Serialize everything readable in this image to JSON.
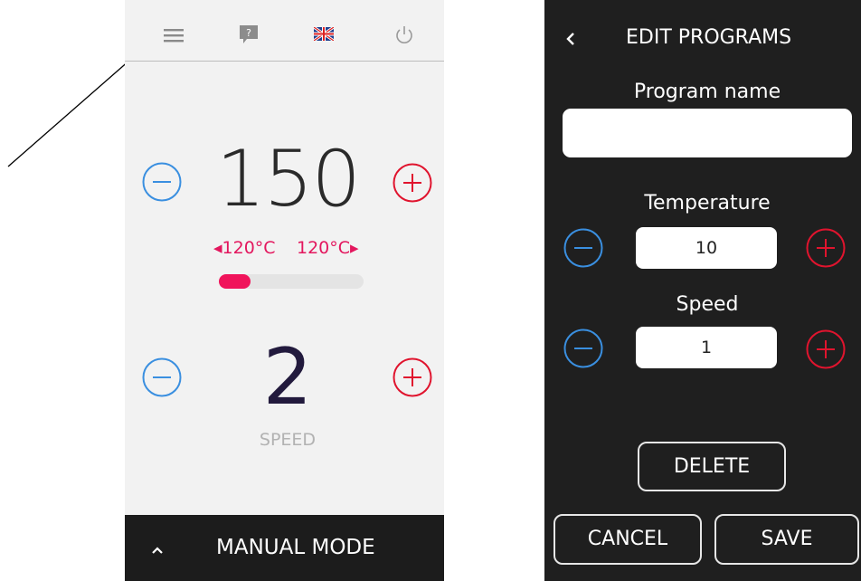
{
  "left_screen": {
    "toolbar": {
      "menu_icon": "hamburger-menu-icon",
      "help_icon": "question-speech-icon",
      "help_glyph": "?",
      "language_icon": "uk-flag-icon",
      "power_icon": "power-icon"
    },
    "temperature": {
      "value": "150",
      "min_label": "◂120°C",
      "max_label": "120°C▸",
      "progress_fraction": 0.22
    },
    "speed": {
      "value": "2",
      "label": "SPEED"
    },
    "mode_bar": {
      "chevron": "chevron-up-icon",
      "label": "MANUAL MODE"
    }
  },
  "right_screen": {
    "header": {
      "back_icon": "back-chevron-icon",
      "title": "EDIT PROGRAMS"
    },
    "program_name": {
      "label": "Program name",
      "value": ""
    },
    "temperature": {
      "label": "Temperature",
      "value": "10"
    },
    "speed": {
      "label": "Speed",
      "value": "1"
    },
    "buttons": {
      "delete": "DELETE",
      "cancel": "CANCEL",
      "save": "SAVE"
    }
  },
  "colors": {
    "minus_blue": "#3a8fe0",
    "plus_red": "#e0142e",
    "accent_pink": "#f0145b"
  }
}
